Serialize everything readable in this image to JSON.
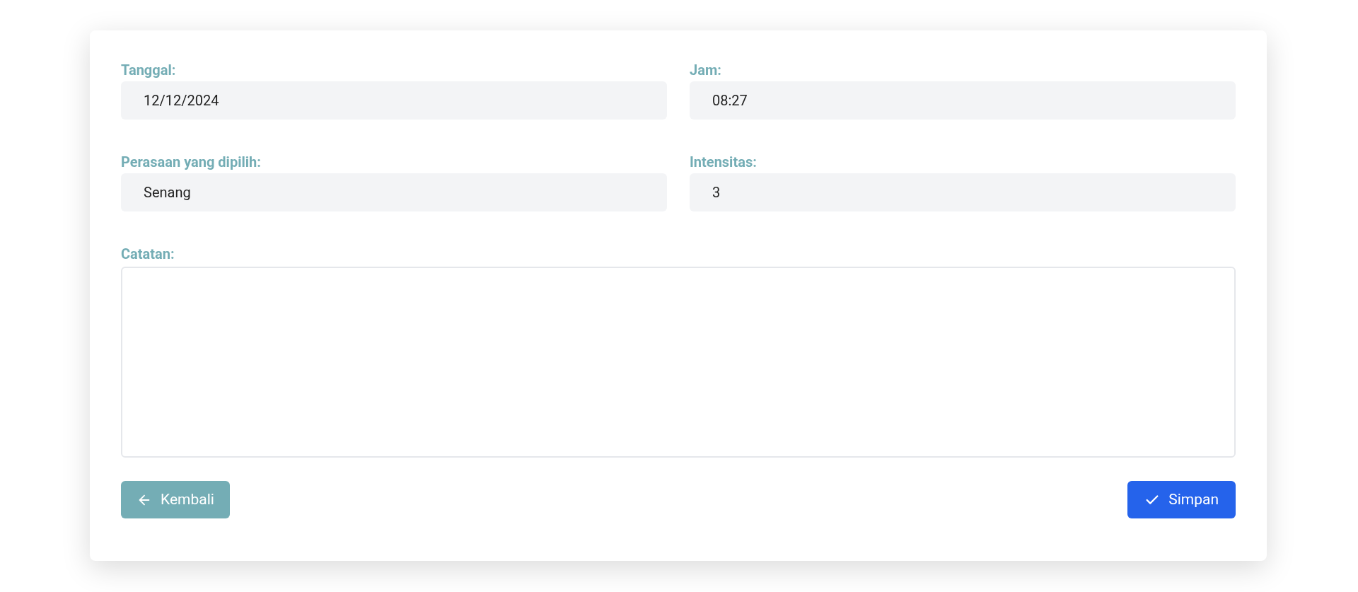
{
  "fields": [
    {
      "label": "Tanggal:",
      "value": "12/12/2024"
    },
    {
      "label": "Jam:",
      "value": "08:27"
    },
    {
      "label": "Perasaan yang dipilih:",
      "value": "Senang"
    },
    {
      "label": "Intensitas:",
      "value": "3"
    }
  ],
  "notes": {
    "label": "Catatan:"
  },
  "buttons": [
    {
      "kind": "back",
      "label": "Kembali"
    },
    {
      "kind": "save",
      "label": "Simpan"
    }
  ]
}
